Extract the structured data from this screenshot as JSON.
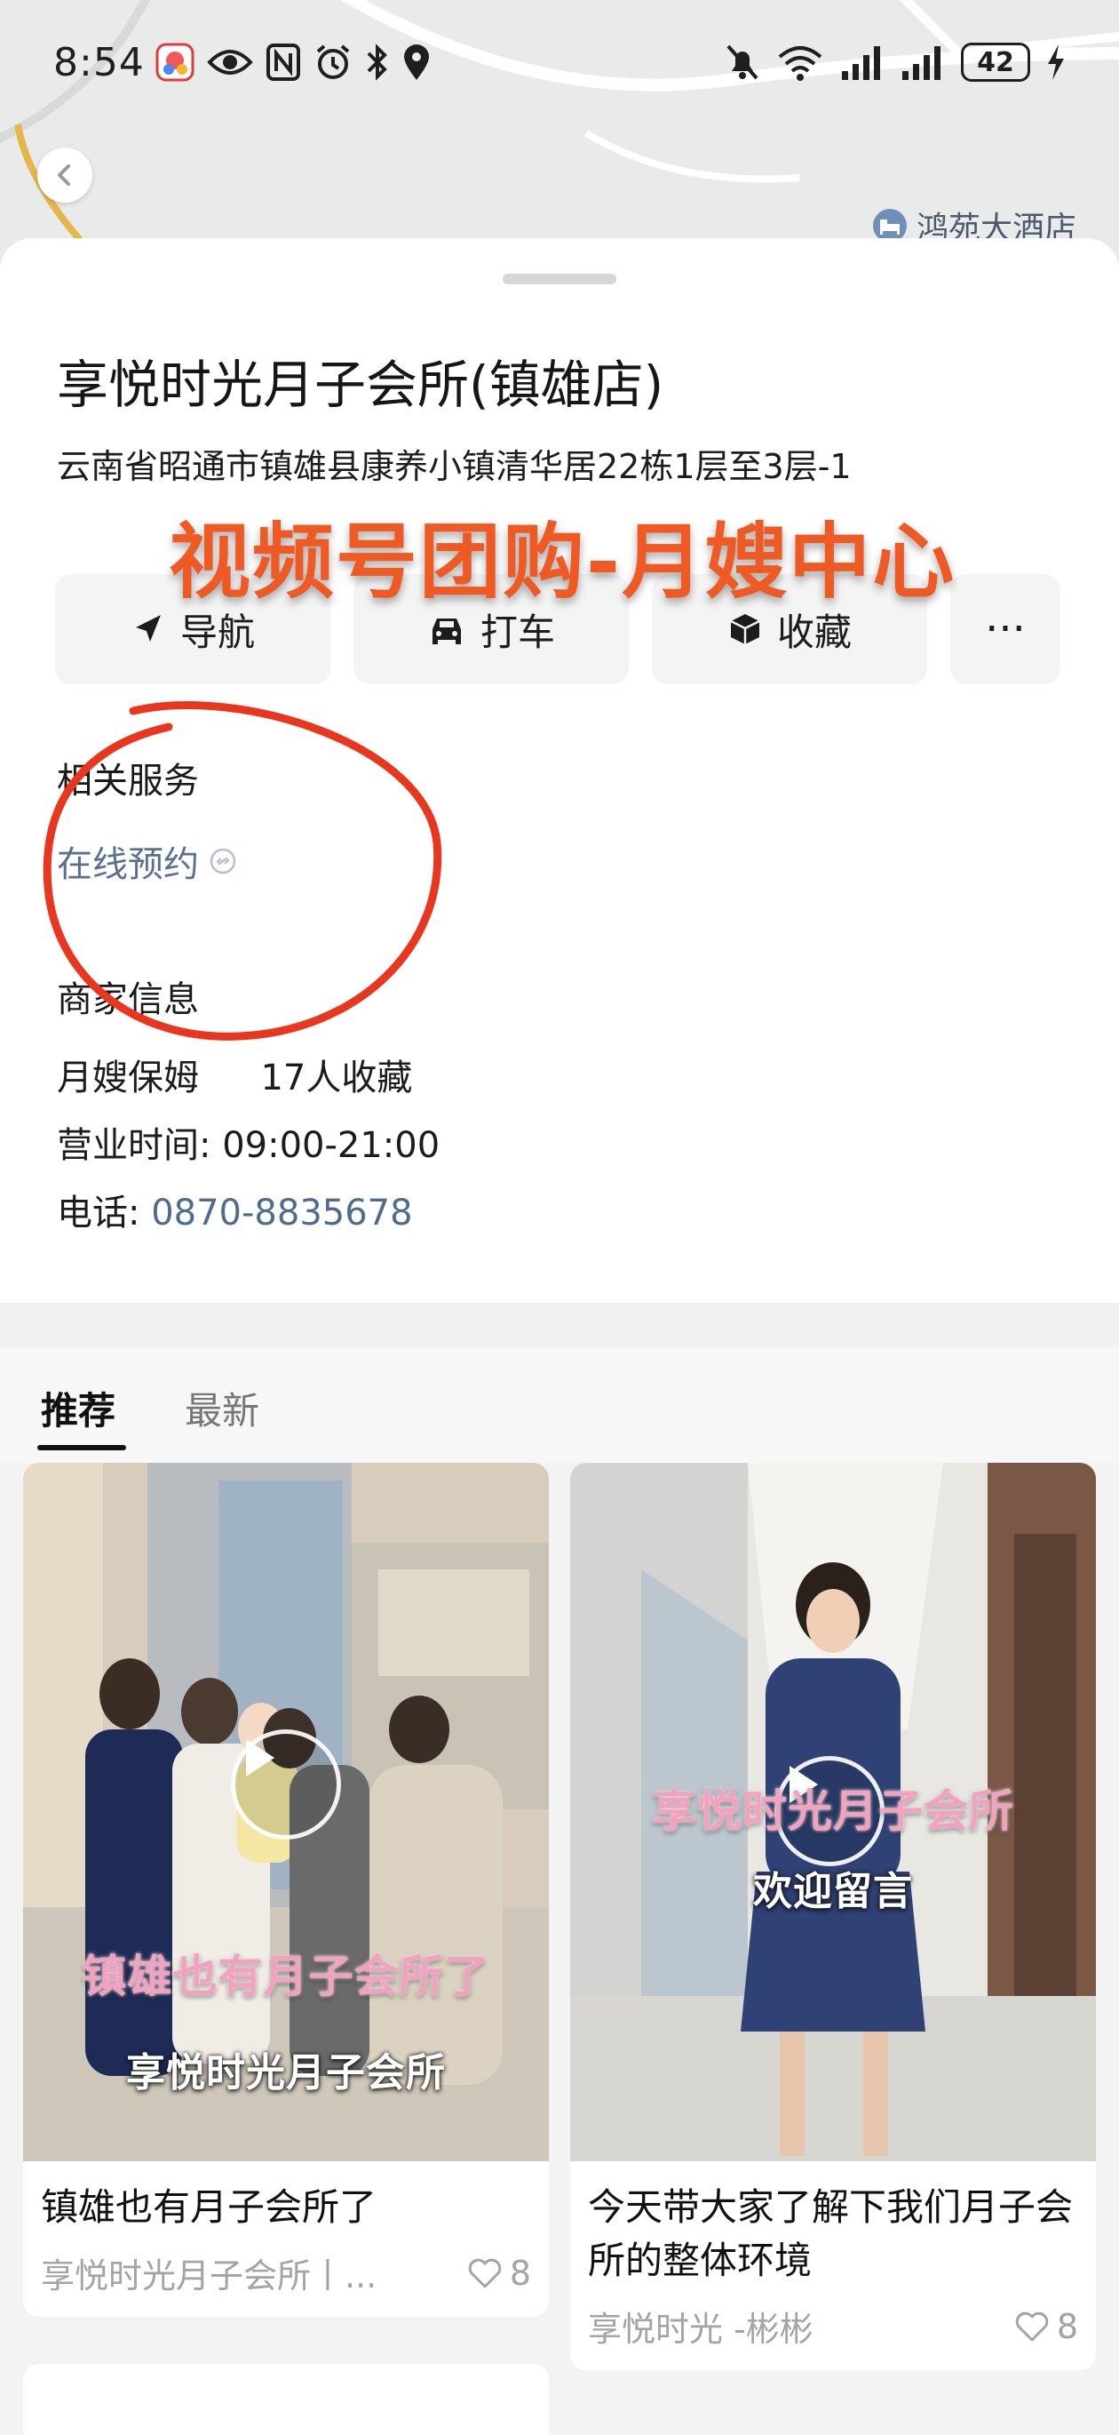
{
  "status_bar": {
    "time": "8:54",
    "battery": "42"
  },
  "map": {
    "poi_label": "鸿苑大酒店"
  },
  "place": {
    "title": "享悦时光月子会所(镇雄店)",
    "address": "云南省昭通市镇雄县康养小镇清华居22栋1层至3层-1"
  },
  "overlay": {
    "promo_text": "视频号团购-月嫂中心",
    "promo_color": "#ef5a24",
    "annotation_color": "#e8371e"
  },
  "actions": {
    "navigate": "导航",
    "taxi": "打车",
    "favorite": "收藏",
    "more": "···"
  },
  "services": {
    "heading": "相关服务",
    "online_booking": "在线预约"
  },
  "merchant": {
    "heading": "商家信息",
    "category": "月嫂保姆",
    "favorites": "17人收藏",
    "hours_label": "营业时间:",
    "hours": "09:00-21:00",
    "phone_label": "电话:",
    "phone": "0870-8835678",
    "phone_color": "#4f6c8e"
  },
  "tabs": {
    "recommended": "推荐",
    "latest": "最新"
  },
  "feed": {
    "cards": [
      {
        "caption_top": "镇雄也有月子会所了",
        "caption_bottom": "享悦时光月子会所",
        "title": "镇雄也有月子会所了",
        "author": "享悦时光月子会所丨...",
        "likes": "8"
      },
      {
        "caption_top": "享悦时光月子会所",
        "caption_bottom": "欢迎留言",
        "title": "今天带大家了解下我们月子会所的整体环境",
        "author": "享悦时光 -彬彬",
        "likes": "8"
      }
    ]
  }
}
